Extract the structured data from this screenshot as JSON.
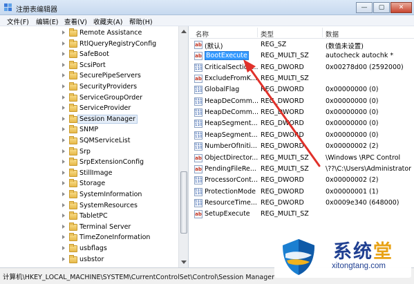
{
  "window": {
    "title": "注册表编辑器",
    "minimize_label": "—",
    "maximize_label": "▢",
    "close_label": "✕"
  },
  "menu": [
    "文件(F)",
    "编辑(E)",
    "查看(V)",
    "收藏夹(A)",
    "帮助(H)"
  ],
  "tree": {
    "selected": "Session Manager",
    "items": [
      "Remote Assistance",
      "RtlQueryRegistryConfig",
      "SafeBoot",
      "ScsiPort",
      "SecurePipeServers",
      "SecurityProviders",
      "ServiceGroupOrder",
      "ServiceProvider",
      "Session Manager",
      "SNMP",
      "SQMServiceList",
      "Srp",
      "SrpExtensionConfig",
      "StillImage",
      "Storage",
      "SystemInformation",
      "SystemResources",
      "TabletPC",
      "Terminal Server",
      "TimeZoneInformation",
      "usbflags",
      "usbstor"
    ]
  },
  "list": {
    "columns": [
      "名称",
      "类型",
      "数据"
    ],
    "selected": "BootExecute",
    "rows": [
      {
        "name": "(默认)",
        "type": "REG_SZ",
        "data": "(数值未设置)",
        "icon": "sz"
      },
      {
        "name": "BootExecute",
        "type": "REG_MULTI_SZ",
        "data": "autocheck autochk *",
        "icon": "sz"
      },
      {
        "name": "CriticalSection...",
        "type": "REG_DWORD",
        "data": "0x00278d00 (2592000)",
        "icon": "bin"
      },
      {
        "name": "ExcludeFromK...",
        "type": "REG_MULTI_SZ",
        "data": "",
        "icon": "sz"
      },
      {
        "name": "GlobalFlag",
        "type": "REG_DWORD",
        "data": "0x00000000 (0)",
        "icon": "bin"
      },
      {
        "name": "HeapDeComm...",
        "type": "REG_DWORD",
        "data": "0x00000000 (0)",
        "icon": "bin"
      },
      {
        "name": "HeapDeComm...",
        "type": "REG_DWORD",
        "data": "0x00000000 (0)",
        "icon": "bin"
      },
      {
        "name": "HeapSegment...",
        "type": "REG_DWORD",
        "data": "0x00000000 (0)",
        "icon": "bin"
      },
      {
        "name": "HeapSegment...",
        "type": "REG_DWORD",
        "data": "0x00000000 (0)",
        "icon": "bin"
      },
      {
        "name": "NumberOfIniti...",
        "type": "REG_DWORD",
        "data": "0x00000002 (2)",
        "icon": "bin"
      },
      {
        "name": "ObjectDirector...",
        "type": "REG_MULTI_SZ",
        "data": "\\Windows \\RPC Control",
        "icon": "sz"
      },
      {
        "name": "PendingFileRe...",
        "type": "REG_MULTI_SZ",
        "data": "\\??\\C:\\Users\\Administrator",
        "icon": "sz"
      },
      {
        "name": "ProcessorCont...",
        "type": "REG_DWORD",
        "data": "0x00000002 (2)",
        "icon": "bin"
      },
      {
        "name": "ProtectionMode",
        "type": "REG_DWORD",
        "data": "0x00000001 (1)",
        "icon": "bin"
      },
      {
        "name": "ResourceTime...",
        "type": "REG_DWORD",
        "data": "0x0009e340 (648000)",
        "icon": "bin"
      },
      {
        "name": "SetupExecute",
        "type": "REG_MULTI_SZ",
        "data": "",
        "icon": "sz"
      }
    ]
  },
  "status": {
    "path": "计算机\\HKEY_LOCAL_MACHINE\\SYSTEM\\CurrentControlSet\\Control\\Session Manager"
  },
  "watermark": {
    "title_chars": [
      "系",
      "统",
      "堂"
    ],
    "url": "xitongtang.com"
  },
  "colors": {
    "selection": "#3399ff",
    "annotation_arrow": "#e0312a",
    "watermark_blue": "#1f3f91",
    "watermark_orange": "#e8a216"
  }
}
